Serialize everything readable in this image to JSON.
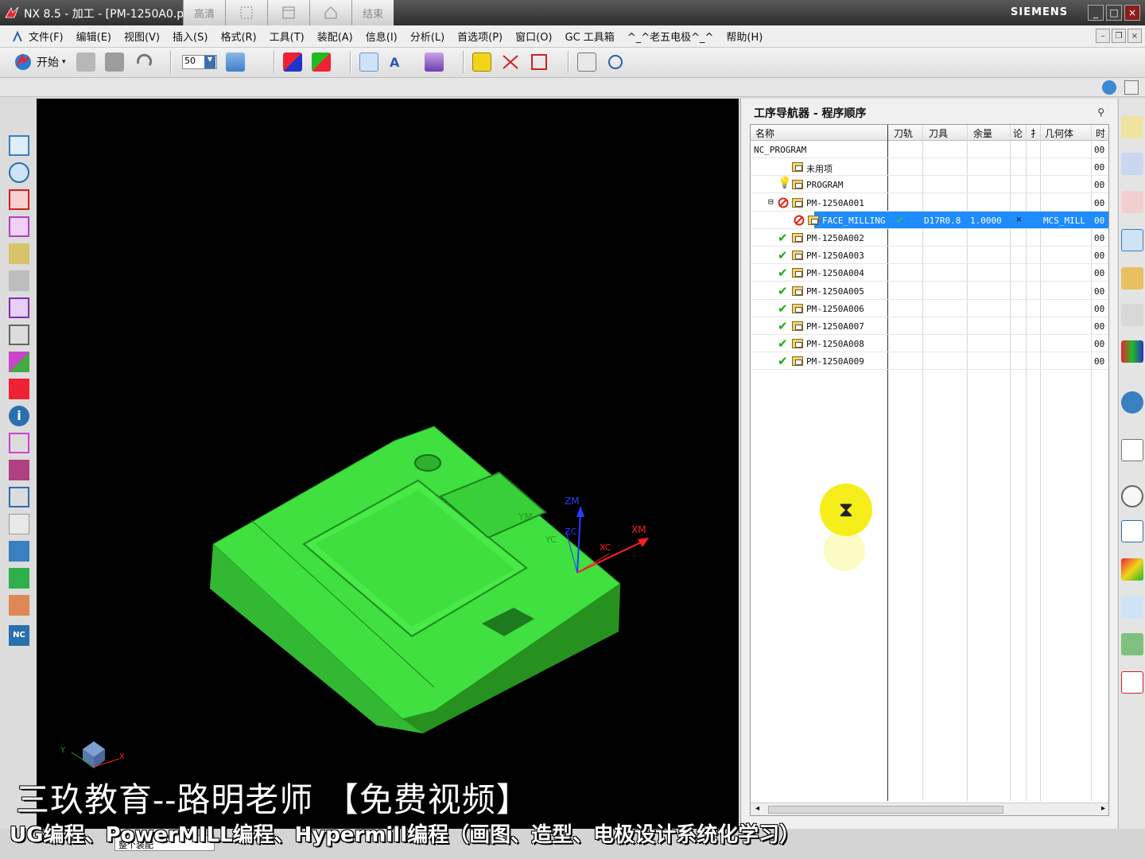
{
  "window": {
    "title": "NX 8.5 - 加工 - [PM-1250A0.p",
    "brand": "SIEMENS",
    "recorder_buttons": [
      "高清",
      "",
      "",
      "",
      "结束"
    ],
    "controls": [
      "_",
      "□",
      "×"
    ]
  },
  "menu": {
    "items": [
      "文件(F)",
      "编辑(E)",
      "视图(V)",
      "插入(S)",
      "格式(R)",
      "工具(T)",
      "装配(A)",
      "信息(I)",
      "分析(L)",
      "首选项(P)",
      "窗口(O)",
      "GC 工具箱",
      "^_^老五电极^_^",
      "帮助(H)"
    ]
  },
  "toolbar": {
    "start_label": "开始",
    "zoom_value": "50"
  },
  "viewport": {
    "axis_labels": {
      "zm": "ZM",
      "ym": "YM",
      "xm": "XM",
      "yc": "YC",
      "zc": "ZC",
      "xc": "XC",
      "triad_x": "X",
      "triad_y": "Y"
    },
    "model_color": "#39e63a"
  },
  "navigator": {
    "title": "工序导航器 - 程序顺序",
    "columns": [
      "名称",
      "刀轨",
      "刀具",
      "余量",
      "论",
      "扌",
      "几何体",
      "时"
    ],
    "rows": [
      {
        "name": "NC_PROGRAM",
        "indent": 0,
        "status": "",
        "path": "",
        "tool": "",
        "stock": "",
        "c5": "",
        "c6": "",
        "geometry": "",
        "time": "00"
      },
      {
        "name": "未用项",
        "indent": 1,
        "status": "",
        "path": "",
        "tool": "",
        "stock": "",
        "c5": "",
        "c6": "",
        "geometry": "",
        "time": "00"
      },
      {
        "name": "PROGRAM",
        "indent": 1,
        "status": "bulb",
        "path": "",
        "tool": "",
        "stock": "",
        "c5": "",
        "c6": "",
        "geometry": "",
        "time": "00"
      },
      {
        "name": "PM-1250A001",
        "indent": 1,
        "status": "no",
        "expand": "⊟",
        "path": "",
        "tool": "",
        "stock": "",
        "c5": "",
        "c6": "",
        "geometry": "",
        "time": "00"
      },
      {
        "name": "FACE_MILLING",
        "indent": 2,
        "status": "no",
        "selected": true,
        "path": "✔",
        "tool": "D17R0.8",
        "stock": "1.0000",
        "c5": "",
        "c6": "",
        "geometry": "MCS_MILL",
        "time": "00"
      },
      {
        "name": "PM-1250A002",
        "indent": 1,
        "status": "ok",
        "path": "",
        "tool": "",
        "stock": "",
        "c5": "",
        "c6": "",
        "geometry": "",
        "time": "00"
      },
      {
        "name": "PM-1250A003",
        "indent": 1,
        "status": "ok",
        "path": "",
        "tool": "",
        "stock": "",
        "c5": "",
        "c6": "",
        "geometry": "",
        "time": "00"
      },
      {
        "name": "PM-1250A004",
        "indent": 1,
        "status": "ok",
        "path": "",
        "tool": "",
        "stock": "",
        "c5": "",
        "c6": "",
        "geometry": "",
        "time": "00"
      },
      {
        "name": "PM-1250A005",
        "indent": 1,
        "status": "ok",
        "path": "",
        "tool": "",
        "stock": "",
        "c5": "",
        "c6": "",
        "geometry": "",
        "time": "00"
      },
      {
        "name": "PM-1250A006",
        "indent": 1,
        "status": "ok",
        "path": "",
        "tool": "",
        "stock": "",
        "c5": "",
        "c6": "",
        "geometry": "",
        "time": "00"
      },
      {
        "name": "PM-1250A007",
        "indent": 1,
        "status": "ok",
        "path": "",
        "tool": "",
        "stock": "",
        "c5": "",
        "c6": "",
        "geometry": "",
        "time": "00"
      },
      {
        "name": "PM-1250A008",
        "indent": 1,
        "status": "ok",
        "path": "",
        "tool": "",
        "stock": "",
        "c5": "",
        "c6": "",
        "geometry": "",
        "time": "00"
      },
      {
        "name": "PM-1250A009",
        "indent": 1,
        "status": "ok",
        "path": "",
        "tool": "",
        "stock": "",
        "c5": "",
        "c6": "",
        "geometry": "",
        "time": "00"
      }
    ]
  },
  "status_bar": {
    "filter_value": "整个装配"
  },
  "captions": {
    "line1": "三玖教育--路明老师  【免费视频】",
    "line2": "UG编程、PowerMILL编程、Hypermill编程（画图、造型、电极设计系统化学习）"
  },
  "colors": {
    "selection": "#1e8bff",
    "ok": "#1aa81a",
    "no": "#e0241b",
    "cursor": "#f5ee1b"
  }
}
